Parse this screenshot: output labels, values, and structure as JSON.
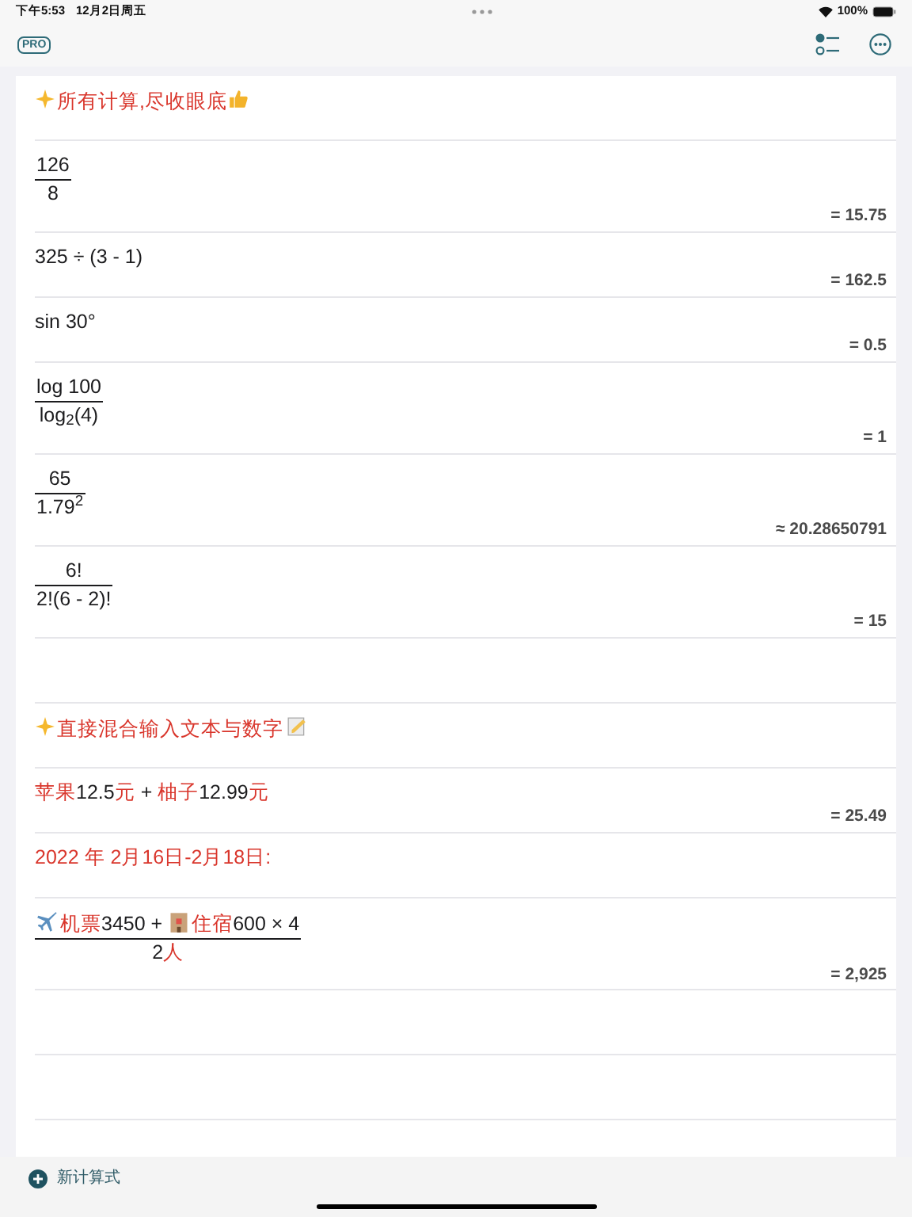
{
  "status_bar": {
    "time": "下午5:53",
    "date": "12月2日周五",
    "battery": "100%"
  },
  "toolbar": {
    "badge": "PRO"
  },
  "rows": [
    {
      "kind": "line",
      "segments": [
        {
          "kind": "sparkle"
        },
        {
          "kind": "word",
          "text": "所有计算,尽收眼底"
        },
        {
          "kind": "thumbs-up"
        }
      ]
    },
    {
      "kind": "fraction",
      "numerator": [
        {
          "kind": "text",
          "text": "126"
        }
      ],
      "denominator": [
        {
          "kind": "text",
          "text": "8"
        }
      ],
      "result": "= 15.75"
    },
    {
      "kind": "line",
      "segments": [
        {
          "kind": "text",
          "text": "325 ÷ (3 - 1)"
        }
      ],
      "result": "= 162.5"
    },
    {
      "kind": "line",
      "segments": [
        {
          "kind": "text",
          "text": "sin 30°"
        }
      ],
      "result": "= 0.5"
    },
    {
      "kind": "fraction",
      "numerator": [
        {
          "kind": "text",
          "text": "log 100"
        }
      ],
      "denominator": [
        {
          "kind": "text",
          "text": "log$_{2}$(4)"
        }
      ],
      "result": "= 1"
    },
    {
      "kind": "fraction",
      "numerator": [
        {
          "kind": "text",
          "text": "65"
        }
      ],
      "denominator": [
        {
          "kind": "text",
          "text": "1.79$^{2}$"
        }
      ],
      "result": "≈ 20.28650791"
    },
    {
      "kind": "fraction",
      "numerator": [
        {
          "kind": "text",
          "text": "6!"
        }
      ],
      "denominator": [
        {
          "kind": "text",
          "text": "2!(6 - 2)!"
        }
      ],
      "result": "= 15"
    },
    {
      "kind": "empty"
    },
    {
      "kind": "line",
      "segments": [
        {
          "kind": "sparkle"
        },
        {
          "kind": "word",
          "text": "直接混合输入文本与数字"
        },
        {
          "kind": "memo"
        }
      ]
    },
    {
      "kind": "line",
      "segments": [
        {
          "kind": "word",
          "text": "苹果"
        },
        {
          "kind": "text",
          "text": "12.5"
        },
        {
          "kind": "word",
          "text": "元"
        },
        {
          "kind": "text",
          "text": " + "
        },
        {
          "kind": "word",
          "text": "柚子"
        },
        {
          "kind": "text",
          "text": "12.99"
        },
        {
          "kind": "word",
          "text": "元"
        }
      ],
      "result": "= 25.49"
    },
    {
      "kind": "line",
      "segments": [
        {
          "kind": "word",
          "text": "2022 年 2月16日-2月18日:"
        }
      ]
    },
    {
      "kind": "fraction",
      "numerator": [
        {
          "kind": "airplane"
        },
        {
          "kind": "word",
          "text": "机票"
        },
        {
          "kind": "text",
          "text": "3450 + "
        },
        {
          "kind": "hotel"
        },
        {
          "kind": "word",
          "text": "住宿"
        },
        {
          "kind": "text",
          "text": "600 × 4"
        }
      ],
      "denominator": [
        {
          "kind": "text",
          "text": "2"
        },
        {
          "kind": "word",
          "text": "人"
        }
      ],
      "result": "= 2,925"
    },
    {
      "kind": "empty"
    },
    {
      "kind": "empty"
    }
  ],
  "new_button": {
    "label": "新计算式"
  }
}
